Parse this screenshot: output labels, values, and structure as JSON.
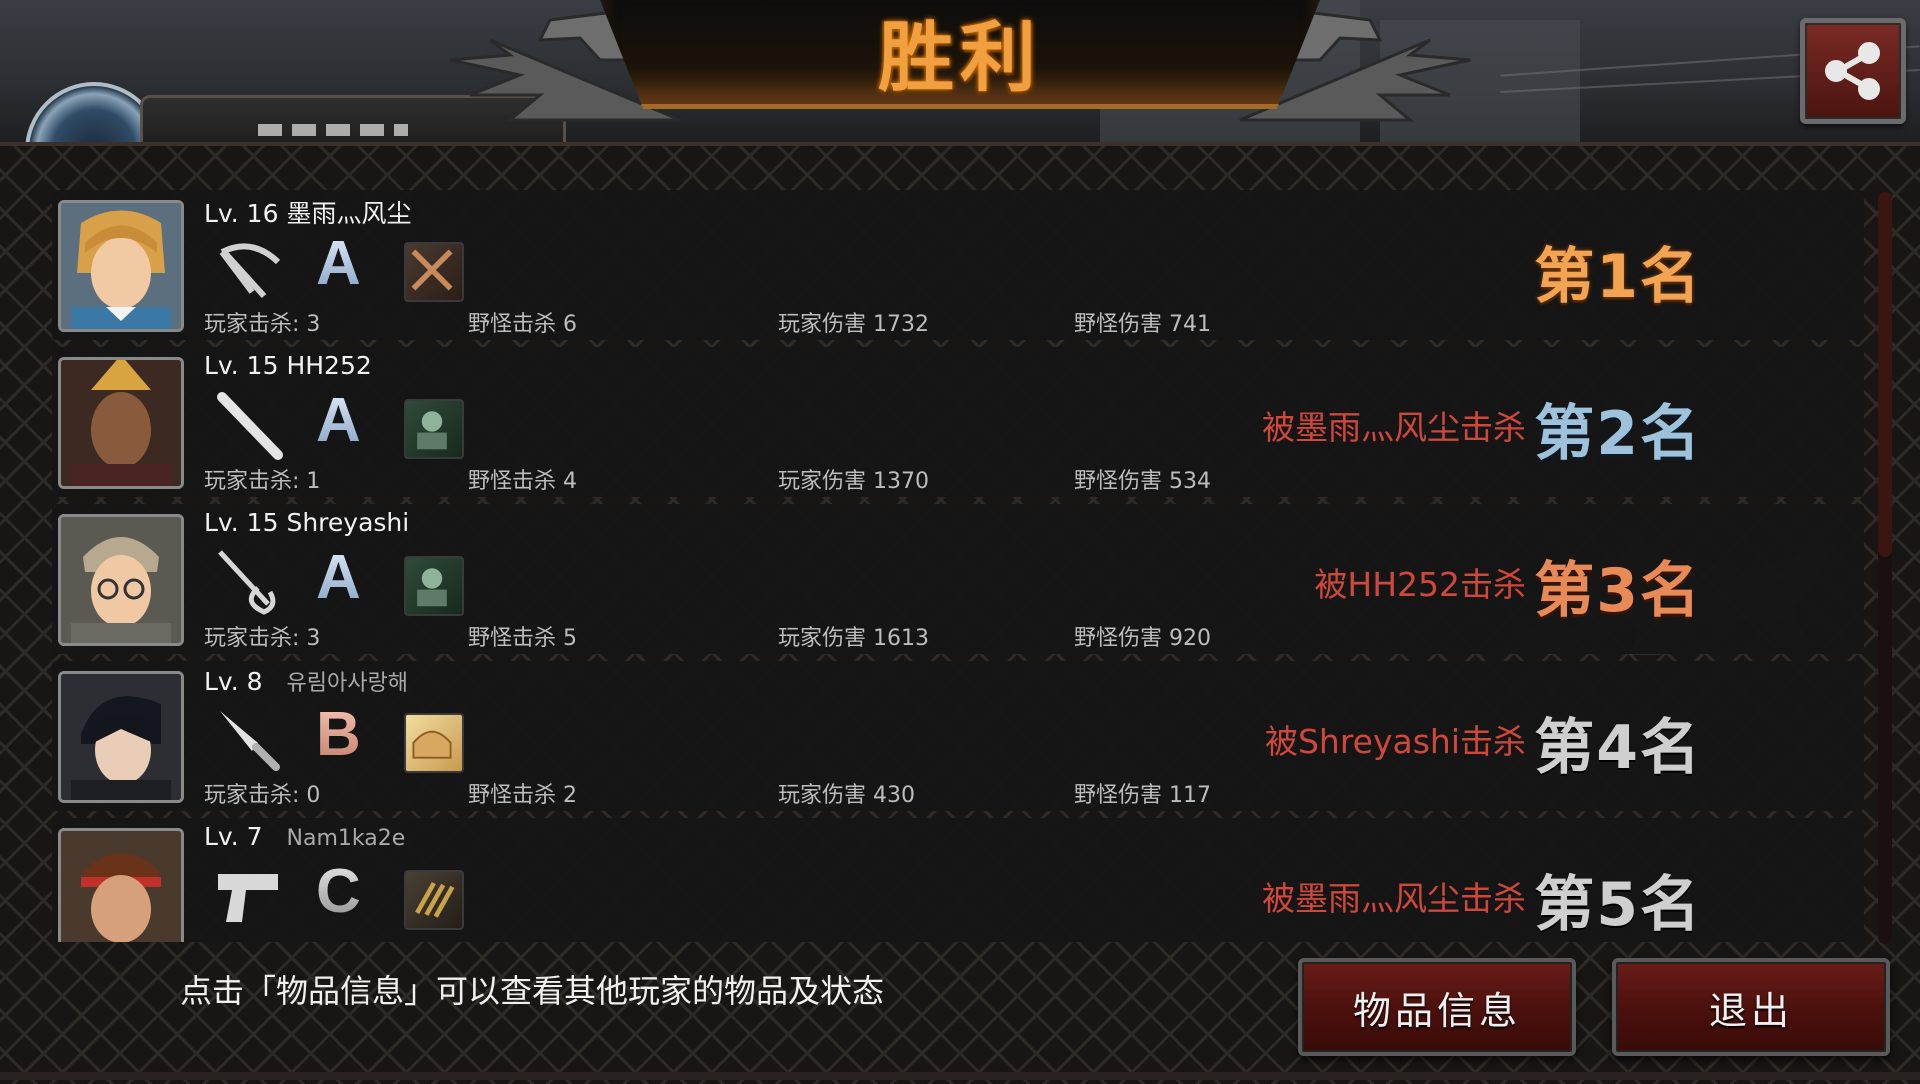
{
  "header": {
    "title": "胜利",
    "share_icon": "share-icon"
  },
  "colors": {
    "kill_text": "#d1473a",
    "rank_gold": "#f2a452",
    "button_red": "#6a1c18"
  },
  "players": [
    {
      "level": "Lv. 16",
      "name": "墨雨灬风尘",
      "name_ko": "",
      "weapon_icon": "crossbow-icon",
      "grade": "A",
      "grade_plus": "+",
      "item_icon": "crossed-blades-icon",
      "player_kills": "玩家击杀: 3",
      "monster_kills": "野怪击杀 6",
      "player_damage": "玩家伤害 1732",
      "monster_damage": "野怪伤害 741",
      "killed_by": "",
      "rank": "第1名"
    },
    {
      "level": "Lv. 15",
      "name": "HH252",
      "name_ko": "",
      "weapon_icon": "baseball-bat-icon",
      "grade": "A",
      "grade_plus": "",
      "item_icon": "soldier-portrait-icon",
      "player_kills": "玩家击杀: 1",
      "monster_kills": "野怪击杀 4",
      "player_damage": "玩家伤害 1370",
      "monster_damage": "野怪伤害 534",
      "killed_by": "被墨雨灬风尘击杀",
      "rank": "第2名"
    },
    {
      "level": "Lv. 15",
      "name": "Shreyashi",
      "name_ko": "",
      "weapon_icon": "rapier-icon",
      "grade": "A",
      "grade_plus": "+",
      "item_icon": "soldier-portrait-icon",
      "player_kills": "玩家击杀: 3",
      "monster_kills": "野怪击杀 5",
      "player_damage": "玩家伤害 1613",
      "monster_damage": "野怪伤害 920",
      "killed_by": "被HH252击杀",
      "rank": "第3名"
    },
    {
      "level": "Lv. 8",
      "name": "",
      "name_ko": "유림아사랑해",
      "weapon_icon": "kitchen-knife-icon",
      "grade": "B",
      "grade_plus": "",
      "item_icon": "bread-icon",
      "player_kills": "玩家击杀: 0",
      "monster_kills": "野怪击杀 2",
      "player_damage": "玩家伤害 430",
      "monster_damage": "野怪伤害 117",
      "killed_by": "被Shreyashi击杀",
      "rank": "第4名"
    },
    {
      "level": "Lv. 7",
      "name": "",
      "name_ko": "Nam1ka2e",
      "weapon_icon": "pistol-icon",
      "grade": "C",
      "grade_plus": "+",
      "item_icon": "ammo-icon",
      "player_kills": "",
      "monster_kills": "",
      "player_damage": "",
      "monster_damage": "",
      "killed_by": "被墨雨灬风尘击杀",
      "rank": "第5名"
    }
  ],
  "footer": {
    "hint": "点击「物品信息」可以查看其他玩家的物品及状态",
    "items_button": "物品信息",
    "exit_button": "退出"
  }
}
